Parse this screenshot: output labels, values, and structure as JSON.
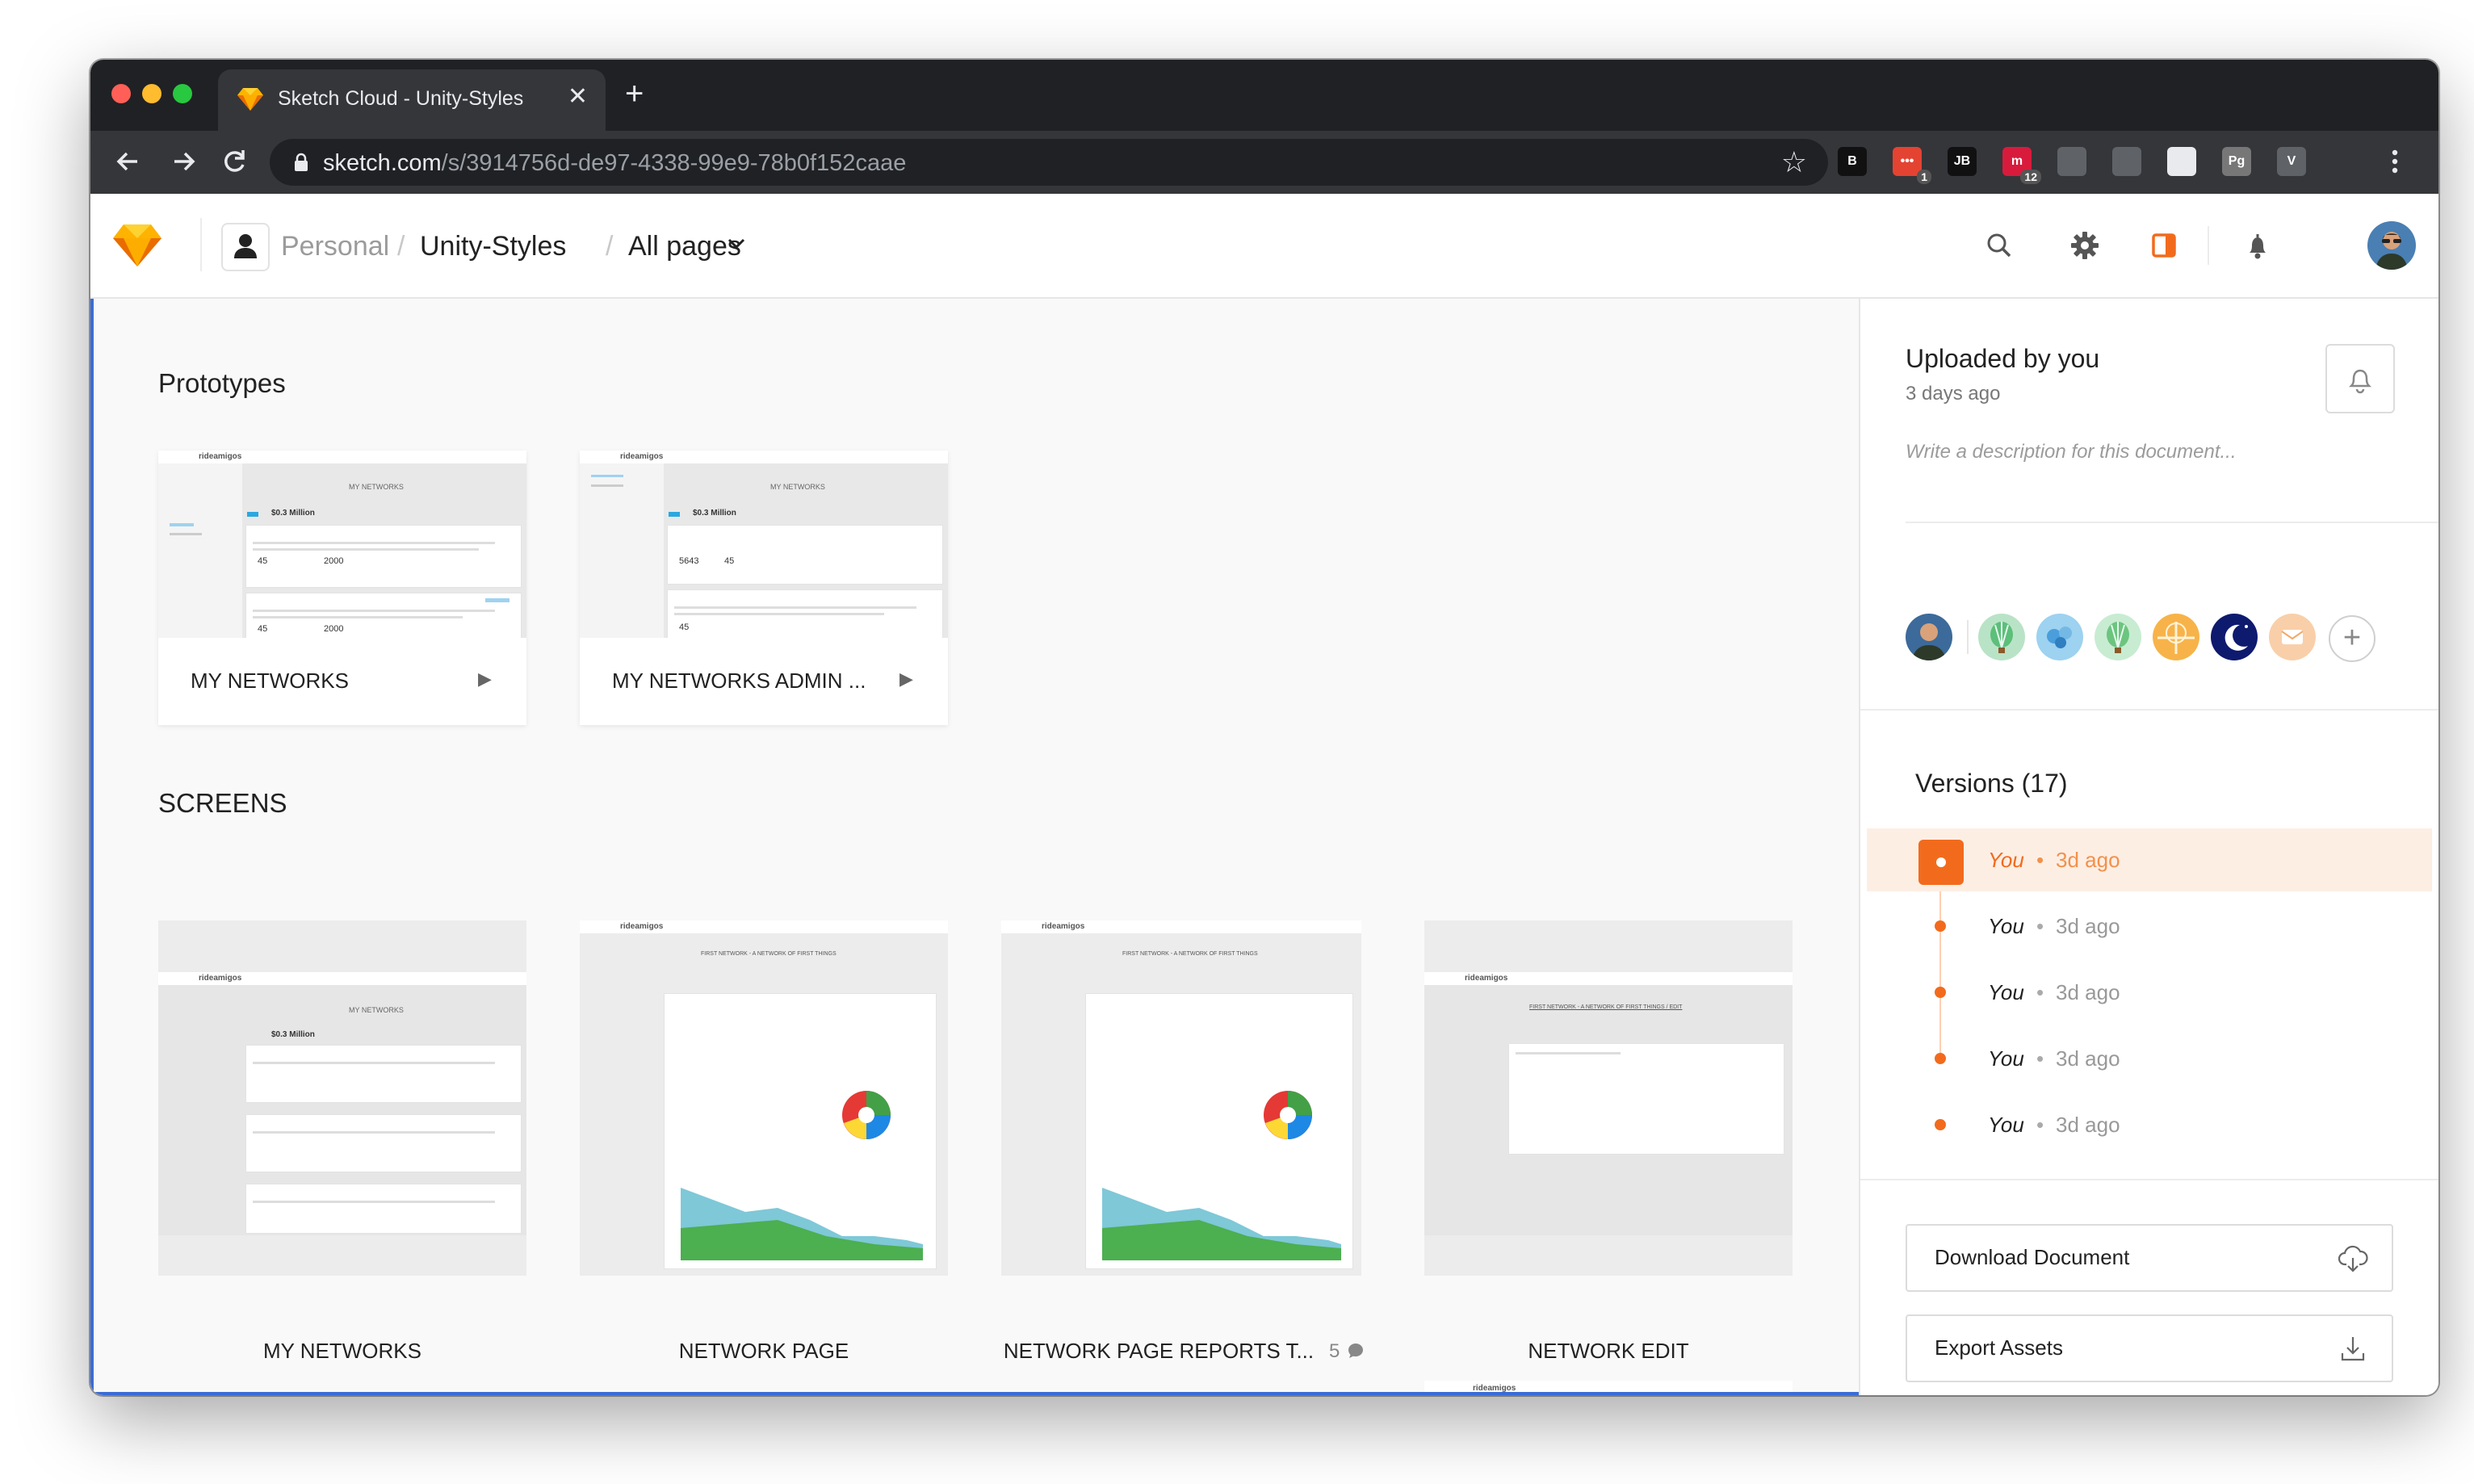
{
  "browser": {
    "tab_title": "Sketch Cloud - Unity-Styles",
    "tab_close": "✕",
    "new_tab": "+",
    "url_host": "sketch.com",
    "url_path": "/s/3914756d-de97-4338-99e9-78b0f152caae",
    "extensions": [
      {
        "name": "b-extension-icon",
        "label": "B",
        "color": "#111111"
      },
      {
        "name": "todoist-extension-icon",
        "label": "•••",
        "color": "#e44332",
        "badge": "1"
      },
      {
        "name": "jb-extension-icon",
        "label": "JB",
        "color": "#111111"
      },
      {
        "name": "m-extension-icon",
        "label": "m",
        "color": "#d81b3c",
        "badge": "12"
      },
      {
        "name": "clock-extension-icon",
        "label": "",
        "color": "#5f6368"
      },
      {
        "name": "pocket-extension-icon",
        "label": "",
        "color": "#5f6368"
      },
      {
        "name": "circle-extension-icon",
        "label": "",
        "color": "#e8eaed"
      },
      {
        "name": "pg-extension-icon",
        "label": "Pg",
        "color": "#777777"
      },
      {
        "name": "vimium-extension-icon",
        "label": "V",
        "color": "#5f6368"
      }
    ]
  },
  "header": {
    "breadcrumb_personal": "Personal",
    "breadcrumb_sep": "/",
    "breadcrumb_project": "Unity-Styles",
    "breadcrumb_pages": "All pages",
    "accent": "#f26b1d"
  },
  "main": {
    "prototypes_title": "Prototypes",
    "prototypes": [
      {
        "label": "MY NETWORKS",
        "mini_title": "MY NETWORKS",
        "mini_value": "$0.3 Million",
        "stat_a": "45",
        "stat_b": "2000",
        "play": "▶"
      },
      {
        "label": "MY NETWORKS ADMIN ...",
        "mini_title": "MY NETWORKS",
        "mini_value": "$0.3 Million",
        "stat_a": "5643",
        "stat_b": "45",
        "play": "▶"
      }
    ],
    "screens_title": "SCREENS",
    "screens": [
      {
        "label": "MY NETWORKS",
        "mini_title": "MY NETWORKS",
        "mini_value": "$0.3 Million"
      },
      {
        "label": "NETWORK PAGE",
        "mini_title": "FIRST NETWORK - A NETWORK OF FIRST THINGS"
      },
      {
        "label": "NETWORK PAGE REPORTS T...",
        "comments": "5",
        "mini_title": "FIRST NETWORK - A NETWORK OF FIRST THINGS"
      },
      {
        "label": "NETWORK EDIT",
        "mini_title": "FIRST NETWORK - A NETWORK OF FIRST THINGS / EDIT"
      }
    ],
    "mini_brand": "rideamigos"
  },
  "sidebar": {
    "uploaded_title": "Uploaded by you",
    "uploaded_time": "3 days ago",
    "description_placeholder": "Write a description for this document...",
    "add_collaborator": "+",
    "versions_title": "Versions (17)",
    "versions": [
      {
        "name": "You",
        "sep": "•",
        "time": "3d ago",
        "active": true
      },
      {
        "name": "You",
        "sep": "•",
        "time": "3d ago",
        "active": false
      },
      {
        "name": "You",
        "sep": "•",
        "time": "3d ago",
        "active": false
      },
      {
        "name": "You",
        "sep": "•",
        "time": "3d ago",
        "active": false
      },
      {
        "name": "You",
        "sep": "•",
        "time": "3d ago",
        "active": false
      }
    ],
    "download_label": "Download Document",
    "export_label": "Export Assets"
  }
}
